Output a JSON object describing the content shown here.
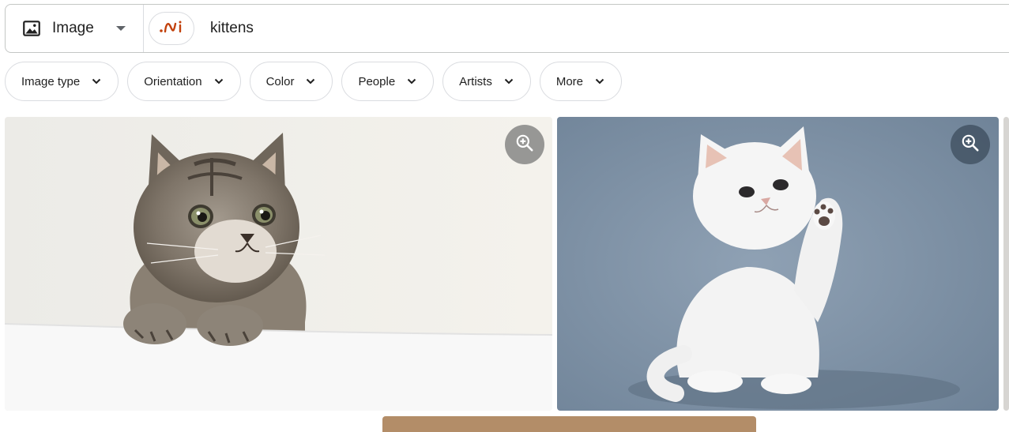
{
  "search": {
    "type_label": "Image",
    "query": "kittens",
    "icons": {
      "image": "image-icon",
      "dropdown": "caret-down-icon",
      "ai": "ai-logo-icon"
    },
    "accent_color": "#c2410c"
  },
  "filters": [
    {
      "label": "Image type"
    },
    {
      "label": "Orientation"
    },
    {
      "label": "Color"
    },
    {
      "label": "People"
    },
    {
      "label": "Artists"
    },
    {
      "label": "More"
    }
  ],
  "results": [
    {
      "subject": "tabby-kitten",
      "zoom_icon": "zoom-in-icon"
    },
    {
      "subject": "white-kitten",
      "zoom_icon": "zoom-in-icon"
    }
  ]
}
